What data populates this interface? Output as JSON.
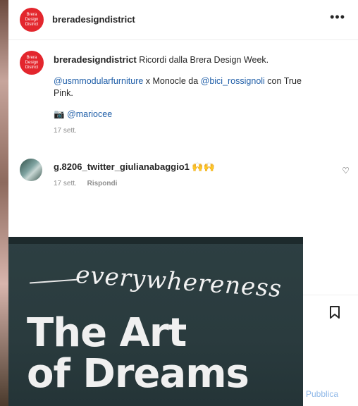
{
  "post": {
    "author": "breradesigndistrict",
    "avatar_text": "Brera Design District",
    "brand_color": "#e3262d",
    "more_icon": "more-horizontal-icon"
  },
  "caption": {
    "author": "breradesigndistrict",
    "text": "Ricordi dalla Brera Design Week.",
    "mention1": "@usmmodularfurniture",
    "mid_text": " x Monocle da ",
    "mention2": "@bici_rossignoli",
    "end_text": " con True Pink.",
    "camera_emoji": "📷",
    "mention3": "@mariocee",
    "time": "17 sett."
  },
  "comment": {
    "author": "g.8206_twitter_giulianabaggio1",
    "emoji": "🙌🙌",
    "time": "17 sett.",
    "reply_label": "Rispondi",
    "like_icon": "heart-icon"
  },
  "actions": {
    "bookmark_icon": "bookmark-icon",
    "publish_label": "Pubblica"
  },
  "photo": {
    "script_text": "everywhereness",
    "title_line1": "The Art",
    "title_line2": "of Dreams"
  }
}
